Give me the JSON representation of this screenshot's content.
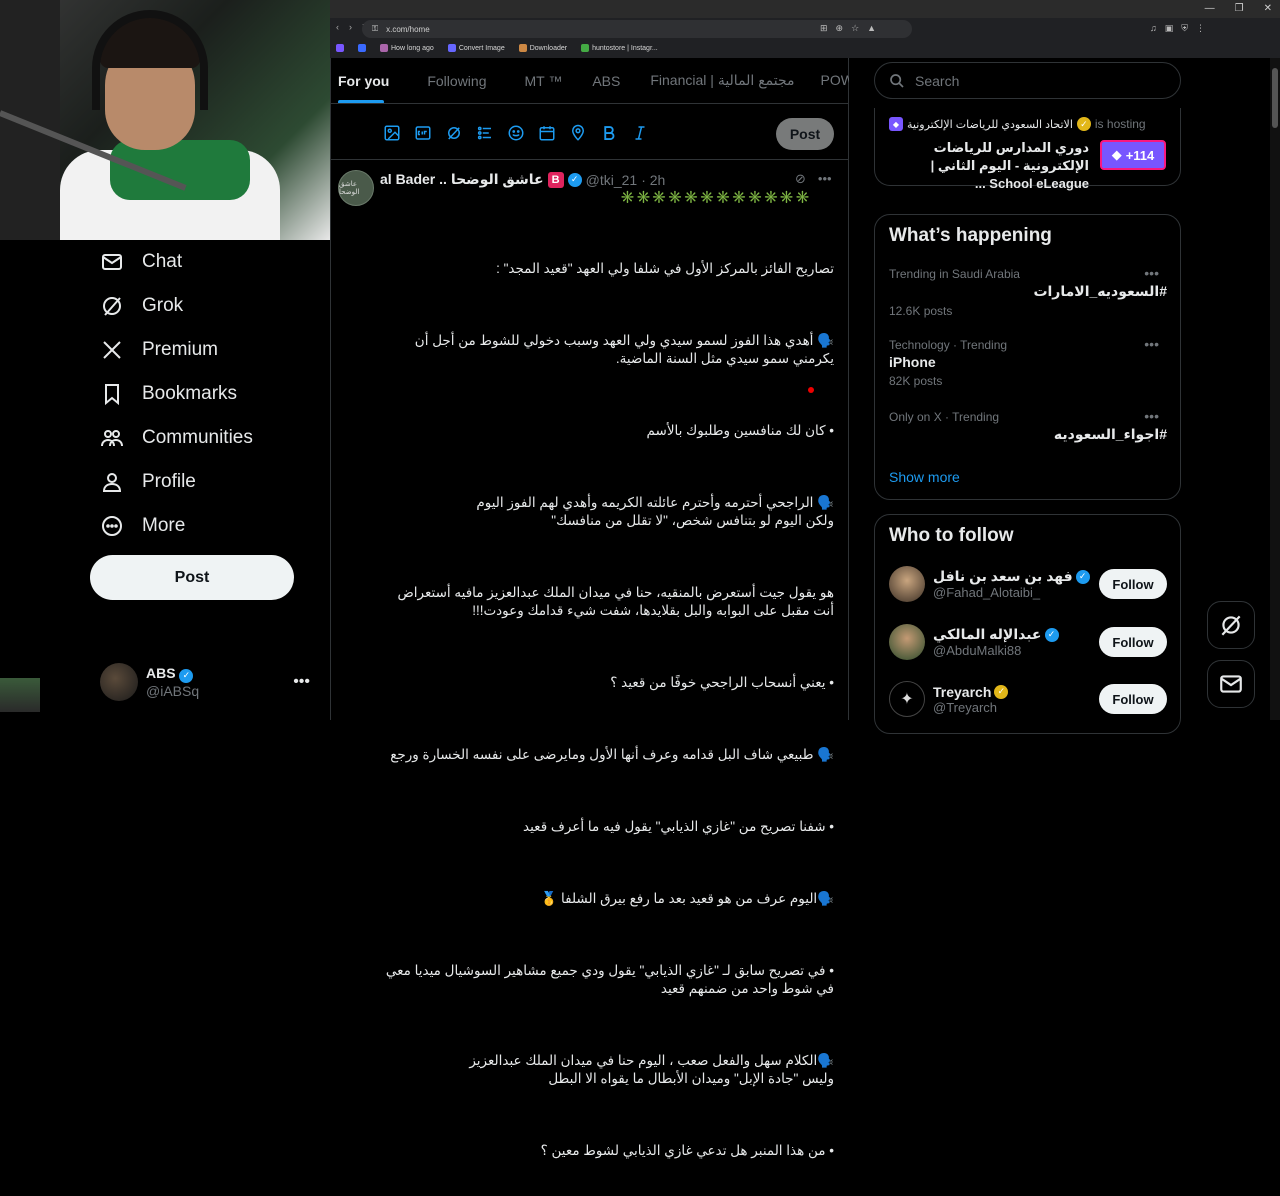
{
  "browser": {
    "url": "x.com/home",
    "bookmarks": [
      "How long ago",
      "Convert Image",
      "Downloader",
      "huntostore | Instagr..."
    ]
  },
  "nav": {
    "items": [
      {
        "label": "Chat",
        "icon": "mail-icon"
      },
      {
        "label": "Grok",
        "icon": "grok-icon"
      },
      {
        "label": "Premium",
        "icon": "x-logo-icon"
      },
      {
        "label": "Bookmarks",
        "icon": "bookmark-icon"
      },
      {
        "label": "Communities",
        "icon": "communities-icon"
      },
      {
        "label": "Profile",
        "icon": "profile-icon"
      },
      {
        "label": "More",
        "icon": "more-icon"
      }
    ],
    "post_label": "Post",
    "account": {
      "name": "ABS",
      "handle": "@iABSq"
    }
  },
  "timeline": {
    "tabs": [
      "For you",
      "Following",
      "MT ™",
      "ABS",
      "Financial | مجتمع المالية",
      "POWR | ور"
    ],
    "composer_post_label": "Post",
    "tweet": {
      "name": "al Bader .. عاشق الوضحا",
      "badge": "B",
      "handle": "@tki_21",
      "time": "· 2h",
      "avatar_text": "عاشق الوضحا",
      "emoji_row": "✳️✳️✳️✳️✳️✳️✳️✳️✳️✳️✳️✳️",
      "paragraphs": [
        "تصاريح الفائز بالمركز الأول في شلفا ولي العهد \"قعيد المجد\" :",
        "🗣️ أهدي هذا الفوز لسمو سيدي ولي العهد وسبب دخولي للشوط من أجل أن يكرمني سمو سيدي مثل السنة الماضية.",
        "• كان لك منافسين وطلبوك بالأسم",
        "🗣️ الراجحي أحترمه وأحترم عائلته الكريمه وأهدي لهم الفوز اليوم\nولكن اليوم لو بتنافس شخص، \"لا تقلل من منافسك\"",
        "هو يقول جيت أستعرض بالمنقيه، حنا في ميدان الملك عبدالعزيز مافيه أستعراض أنت مقبل على البوابه والبل بقلايدها، شفت شيء قدامك وعودت!!!",
        "• يعني أنسحاب الراجحي خوفًا من قعيد ؟",
        "🗣️ طبيعي شاف البل قدامه وعرف أنها الأول ومايرضى على نفسه الخسارة ورجع",
        "• شفنا تصريح من \"غازي الذيابي\" يقول فيه ما أعرف قعيد",
        "🗣️اليوم عرف من هو قعيد بعد ما رفع بيرق الشلفا 🥇",
        "• في تصريح سابق لـ \"غازي الذيابي\" يقول ودي جميع مشاهير السوشيال ميديا معي في شوط واحد من ضمنهم قعيد",
        "🗣️الكلام سهل والفعل صعب ، اليوم حنا في ميدان الملك عبدالعزيز\nوليس \"جادة الإبل\" وميدان الأبطال ما يقواه الا البطل",
        "• من هذا المنبر هل تدعي غازي الذيابي لشوط معين ؟"
      ]
    }
  },
  "sidebar": {
    "search_placeholder": "Search",
    "space": {
      "host": "الاتحاد السعودي للرياضات الإلكترونية",
      "is_hosting": "is hosting",
      "title": "دوري المدارس للرياضات الإلكترونية - اليوم الثاني | School eLeague ...",
      "count": "+114"
    },
    "happening": {
      "title": "What’s happening",
      "trends": [
        {
          "context": "Trending in Saudi Arabia",
          "topic": "#السعوديه_الامارات",
          "count": "12.6K posts",
          "rtl": true
        },
        {
          "context": "Technology · Trending",
          "topic": "iPhone",
          "count": "82K posts",
          "rtl": false
        },
        {
          "context": "Only on X · Trending",
          "topic": "#اجواء_السعوديه",
          "count": "",
          "rtl": true
        }
      ],
      "show_more": "Show more"
    },
    "who_to_follow": {
      "title": "Who to follow",
      "follow_label": "Follow",
      "users": [
        {
          "name": "فهد بن سعد بن نافل",
          "handle": "@Fahad_Alotaibi_",
          "verified": "blue"
        },
        {
          "name": "عبدالإله المالكي",
          "handle": "@AbduMalki88",
          "verified": "blue"
        },
        {
          "name": "Treyarch",
          "handle": "@Treyarch",
          "verified": "gold"
        }
      ]
    }
  },
  "colors": {
    "accent": "#1d9bf0",
    "background": "#000000",
    "border": "#2f3336",
    "muted": "#71767b"
  }
}
